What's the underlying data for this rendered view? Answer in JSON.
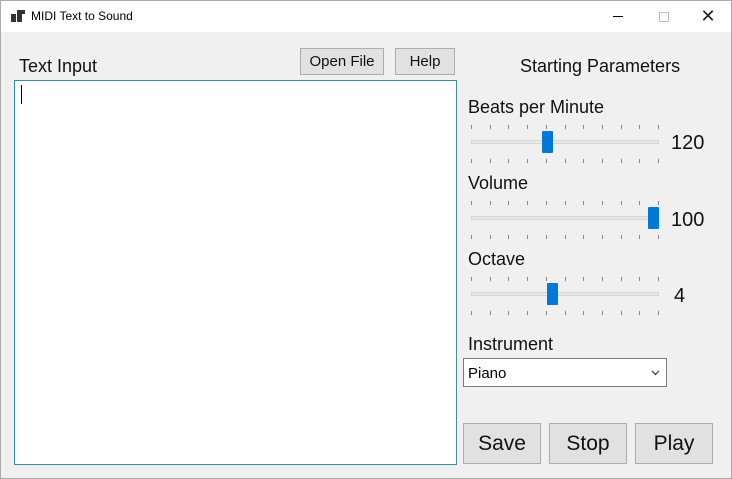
{
  "window": {
    "title": "MIDI Text to Sound"
  },
  "editor": {
    "label": "Text Input",
    "value": "",
    "open_file_label": "Open File",
    "help_label": "Help"
  },
  "parameters": {
    "heading": "Starting Parameters",
    "bpm": {
      "label": "Beats per Minute",
      "value": "120",
      "position": 0.4
    },
    "volume": {
      "label": "Volume",
      "value": "100",
      "position": 1.0
    },
    "octave": {
      "label": "Octave",
      "value": "4",
      "position": 0.43
    },
    "instrument": {
      "label": "Instrument",
      "selected": "Piano"
    }
  },
  "actions": {
    "save_label": "Save",
    "stop_label": "Stop",
    "play_label": "Play"
  },
  "colors": {
    "accent": "#0078d7"
  }
}
